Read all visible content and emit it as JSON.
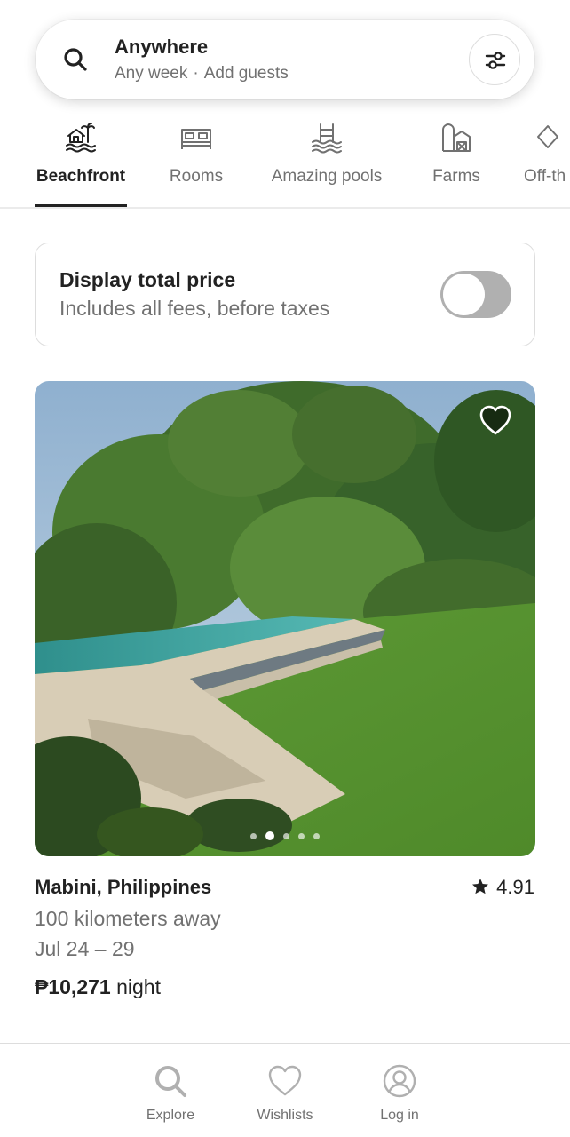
{
  "search": {
    "title": "Anywhere",
    "week": "Any week",
    "separator": "·",
    "guests": "Add guests",
    "icon": "search-icon",
    "filter_icon": "filter-icon"
  },
  "categories": [
    {
      "label": "Beachfront",
      "icon": "beachfront-icon",
      "active": true
    },
    {
      "label": "Rooms",
      "icon": "bed-icon",
      "active": false
    },
    {
      "label": "Amazing pools",
      "icon": "pool-icon",
      "active": false
    },
    {
      "label": "Farms",
      "icon": "farm-icon",
      "active": false
    },
    {
      "label": "Off-th",
      "icon": "diamond-icon",
      "active": false
    }
  ],
  "price_toggle": {
    "title": "Display total price",
    "subtitle": "Includes all fees, before taxes",
    "enabled": false
  },
  "listing": {
    "location": "Mabini, Philippines",
    "rating": "4.91",
    "distance": "100 kilometers away",
    "dates": "Jul 24 – 29",
    "price": "₱10,271",
    "price_unit": "night",
    "photo_count": 5,
    "active_photo": 1
  },
  "bottom_nav": [
    {
      "label": "Explore",
      "icon": "search-icon"
    },
    {
      "label": "Wishlists",
      "icon": "heart-icon"
    },
    {
      "label": "Log in",
      "icon": "user-icon"
    }
  ],
  "colors": {
    "text_primary": "#222222",
    "text_secondary": "#717171",
    "border": "#dddddd",
    "toggle_off": "#b0b0b0"
  }
}
